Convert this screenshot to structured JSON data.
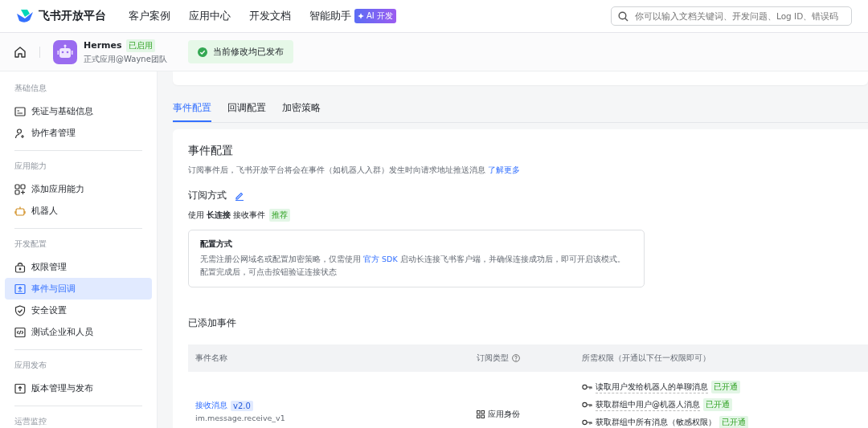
{
  "topbar": {
    "brand": "飞书开放平台",
    "nav": [
      {
        "label": "客户案例"
      },
      {
        "label": "应用中心"
      },
      {
        "label": "开发文档"
      },
      {
        "label": "智能助手",
        "badge": "AI 开发"
      }
    ],
    "search": {
      "placeholder": "你可以输入文档关键词、开发问题、Log ID、错误码"
    }
  },
  "app": {
    "name": "Hermes",
    "status": "已启用",
    "subtitle": "正式应用@Wayne团队",
    "notice": "当前修改均已发布"
  },
  "sidebar": [
    {
      "title": "基础信息",
      "items": [
        {
          "label": "凭证与基础信息",
          "selected": false
        },
        {
          "label": "协作者管理",
          "selected": false
        }
      ]
    },
    {
      "title": "应用能力",
      "items": [
        {
          "label": "添加应用能力",
          "selected": false
        },
        {
          "label": "机器人",
          "selected": false
        }
      ]
    },
    {
      "title": "开发配置",
      "items": [
        {
          "label": "权限管理",
          "selected": false
        },
        {
          "label": "事件与回调",
          "selected": true
        },
        {
          "label": "安全设置",
          "selected": false
        },
        {
          "label": "测试企业和人员",
          "selected": false
        }
      ]
    },
    {
      "title": "应用发布",
      "items": [
        {
          "label": "版本管理与发布",
          "selected": false
        }
      ]
    },
    {
      "title": "运营监控"
    }
  ],
  "tabs": [
    {
      "label": "事件配置",
      "selected": true
    },
    {
      "label": "回调配置",
      "selected": false
    },
    {
      "label": "加密策略",
      "selected": false
    }
  ],
  "section": {
    "title": "事件配置",
    "description": "订阅事件后，飞书开放平台将会在事件（如机器人入群）发生时向请求地址推送消息",
    "link": "了解更多"
  },
  "subscription": {
    "title": "订阅方式",
    "mode": "使用 **长连接** 接收事件",
    "badge": "推荐"
  },
  "config": {
    "title": "配置方式",
    "line1_before": "无需注册公网域名或配置加密策略，仅需使用",
    "line1_link": "官方 SDK",
    "line1_after": "启动长连接飞书客户端，并确保连接成功后，即可开启该模式。",
    "line2": "配置完成后，可点击按钮验证连接状态"
  },
  "events": {
    "title": "已添加事件",
    "columns": [
      {
        "label": "事件名称",
        "help": false
      },
      {
        "label": "订阅类型",
        "help": true
      },
      {
        "label": "所需权限（开通以下任一权限即可）",
        "help": false
      }
    ],
    "rows": [
      {
        "name": "接收消息",
        "version": "v2.0",
        "code": "im.message.receive_v1",
        "type": "应用身份",
        "permissions": [
          {
            "label": "读取用户发给机器人的单聊消息",
            "status": "已开通"
          },
          {
            "label": "获取群组中用户@机器人消息",
            "status": "已开通"
          },
          {
            "label": "获取群组中所有消息（敏感权限）",
            "status": "已开通"
          }
        ]
      }
    ]
  }
}
